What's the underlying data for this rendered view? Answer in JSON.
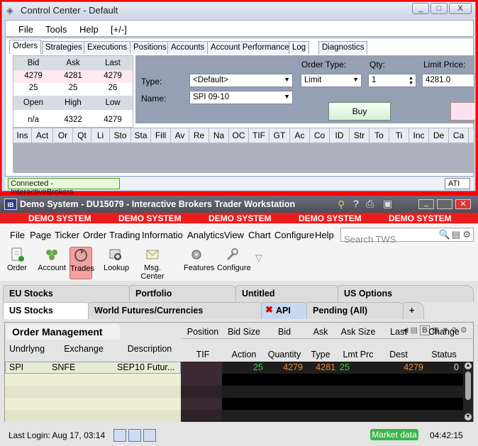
{
  "control_center": {
    "title": "Control Center - Default",
    "window_buttons": [
      "_",
      "□",
      "X"
    ],
    "menu": [
      "File",
      "Tools",
      "Help",
      "[+/-]"
    ],
    "tabs": [
      "Orders",
      "Strategies",
      "Executions",
      "Positions",
      "Accounts",
      "Account Performance",
      "Log",
      "Diagnostics"
    ],
    "quote": {
      "headers1": [
        "Bid",
        "Ask",
        "Last"
      ],
      "row1": [
        "4279",
        "4281",
        "4279"
      ],
      "row2": [
        "25",
        "25",
        "26"
      ],
      "headers2": [
        "Open",
        "High",
        "Low"
      ],
      "row3": [
        "n/a",
        "4322",
        "4279"
      ]
    },
    "order": {
      "type_label": "Type:",
      "type_value": "<Default>",
      "name_label": "Name:",
      "name_value": "SPI 09-10",
      "order_type_label": "Order Type:",
      "order_type_value": "Limit",
      "qty_label": "Qty:",
      "qty_value": "1",
      "limit_label": "Limit Price:",
      "limit_value": "4281.0",
      "buy_label": "Buy"
    },
    "columns": [
      "Ins",
      "Act",
      "Or",
      "Qt",
      "Li",
      "Sto",
      "Sta",
      "Fill",
      "Av",
      "Re",
      "Na",
      "OC",
      "TIF",
      "GT",
      "Ac",
      "Co",
      "ID",
      "Str",
      "To",
      "Ti",
      "Inc",
      "De",
      "Ca"
    ],
    "status": "Connected - InteractiveBrokers",
    "ati": "ATI"
  },
  "tws": {
    "title": "Demo System - DU15079 - Interactive Brokers Trader Workstation",
    "logo": "IB",
    "demo_banner": [
      "DEMO SYSTEM",
      "DEMO SYSTEM",
      "DEMO SYSTEM",
      "DEMO SYSTEM",
      "DEMO SYSTEM"
    ],
    "menu": [
      "File",
      "Page",
      "Ticker",
      "Order",
      "Trading",
      "Informatio",
      "Analytics",
      "View",
      "Chart",
      "Configure",
      "Help"
    ],
    "search_placeholder": "Search TWS",
    "toolbar": [
      "Order",
      "Account",
      "Trades",
      "Lookup",
      "Msg. Center",
      "Features",
      "Configure"
    ],
    "tabs_row1": [
      "EU Stocks",
      "Portfolio",
      "Untitled",
      "US Options"
    ],
    "tabs_row2": [
      "US Stocks",
      "World Futures/Currencies",
      "API",
      "Pending (All)",
      "+"
    ],
    "order_mgmt": {
      "title": "Order Management",
      "headers_top": [
        "Position",
        "Bid Size",
        "Bid",
        "Ask",
        "Ask Size",
        "Last",
        "Change"
      ],
      "headers_bottom": [
        "Undrlyng",
        "Exchange",
        "Description",
        "TIF",
        "Action",
        "Quantity",
        "Type",
        "Lmt Prc",
        "Dest",
        "Status"
      ],
      "row": {
        "underlying": "SPI",
        "exchange": "SNFE",
        "description": "SEP10 Futur...",
        "bid_size": "25",
        "bid": "4279",
        "ask": "4281",
        "ask_size": "25",
        "last": "4279",
        "change": "0"
      }
    },
    "last_login": "Last Login: Aug 17, 03:14",
    "market_data": "Market data",
    "time": "04:42:15"
  },
  "colors": {
    "accent_red": "#ec1c1c",
    "green_value": "#3bd43b",
    "orange_value": "#f08a2a"
  }
}
